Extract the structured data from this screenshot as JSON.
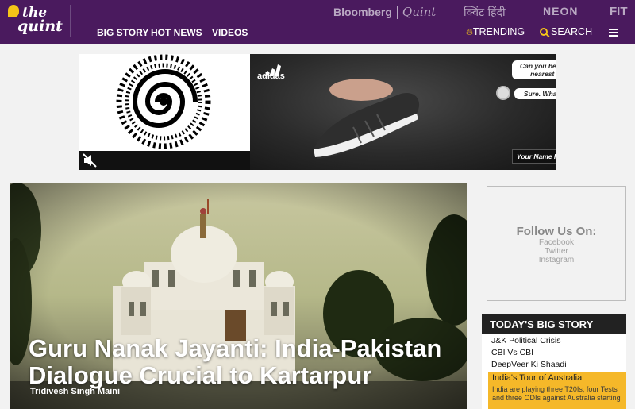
{
  "header": {
    "logo": {
      "line1": "the",
      "line2": "quint"
    },
    "brands": {
      "bloomberg": "Bloomberg",
      "quint": "Quint",
      "hindi": "क्विंट हिंदी",
      "neon": "NEON",
      "fit": "FIT"
    },
    "nav": [
      "BIG STORY",
      "HOT NEWS",
      "VIDEOS"
    ],
    "trending_label": "TRENDING",
    "search_label": "SEARCH"
  },
  "ad": {
    "brand": "adidas",
    "bubble_question": "Can you help me locate the nearest Adidas store",
    "bubble_reply": "Sure. What is your name?",
    "name_placeholder": "Your Name Here"
  },
  "hero": {
    "title": "Guru Nanak Jayanti: India-Pakistan Dialogue Crucial to Kartarpur",
    "author": "Tridivesh Singh Maini"
  },
  "follow": {
    "title": "Follow Us On:",
    "links": [
      "Facebook",
      "Twitter",
      "Instagram"
    ]
  },
  "big_story": {
    "heading": "TODAY'S BIG STORY",
    "items": [
      "J&K Political Crisis",
      "CBI Vs CBI",
      "DeepVeer Ki Shaadi"
    ],
    "feature": {
      "title": "India's Tour of Australia",
      "description": "India are playing three T20Is, four Tests and three ODIs against Australia starting"
    }
  },
  "colors": {
    "header_bg": "#4a1a5e",
    "accent_yellow": "#f5c518",
    "feature_bg": "#f5b829",
    "bigstory_header_bg": "#222222"
  }
}
